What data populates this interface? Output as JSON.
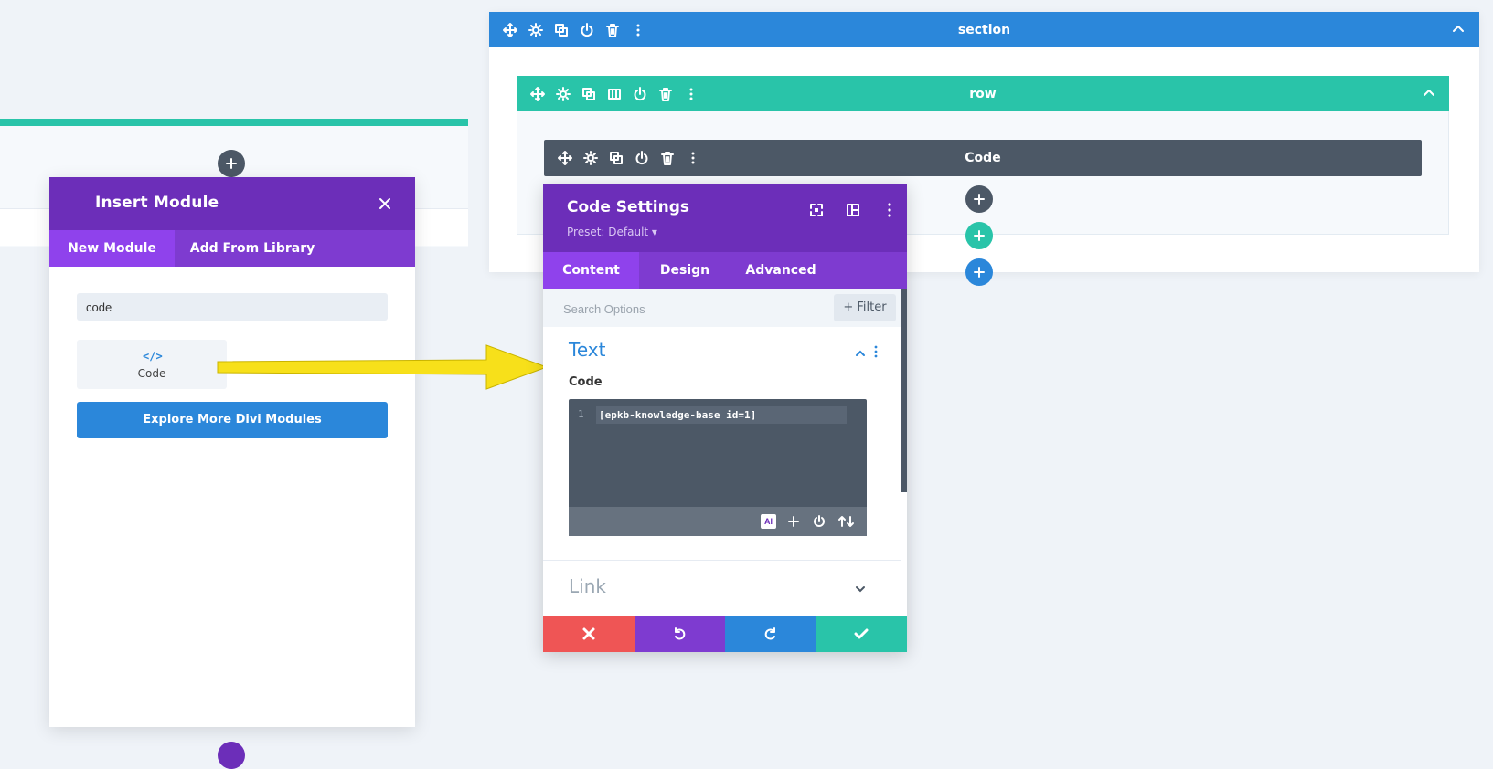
{
  "insert_module": {
    "title": "Insert Module",
    "tabs": [
      {
        "label": "New Module"
      },
      {
        "label": "Add From Library"
      }
    ],
    "search_value": "code",
    "result": {
      "icon": "code-icon",
      "icon_text": "</>",
      "label": "Code"
    },
    "explore_label": "Explore More Divi Modules"
  },
  "builder": {
    "section_label": "section",
    "row_label": "row",
    "module_label": "Code"
  },
  "settings": {
    "title": "Code Settings",
    "preset": "Preset: Default ▾",
    "tabs": [
      {
        "label": "Content"
      },
      {
        "label": "Design"
      },
      {
        "label": "Advanced"
      }
    ],
    "search_placeholder": "Search Options",
    "filter_label": "+ Filter",
    "text_group_title": "Text",
    "code_field_label": "Code",
    "code_line_number": "1",
    "code_value": "[epkb-knowledge-base id=1]",
    "ai_label": "AI",
    "link_group_title": "Link"
  },
  "colors": {
    "purple": "#6c2eb9",
    "blue": "#2b87da",
    "green": "#29c4a9",
    "dark": "#4c5866",
    "red": "#ef5555",
    "arrow_yellow": "#f7e01a"
  },
  "icons": [
    "move-icon",
    "gear-icon",
    "duplicate-icon",
    "columns-icon",
    "power-icon",
    "trash-icon",
    "more-icon",
    "chevron-up-icon",
    "plus-icon",
    "close-icon",
    "expand-icon",
    "split-view-icon",
    "chevron-down-icon",
    "arrows-up-down-icon",
    "undo-icon",
    "redo-icon",
    "check-icon"
  ]
}
